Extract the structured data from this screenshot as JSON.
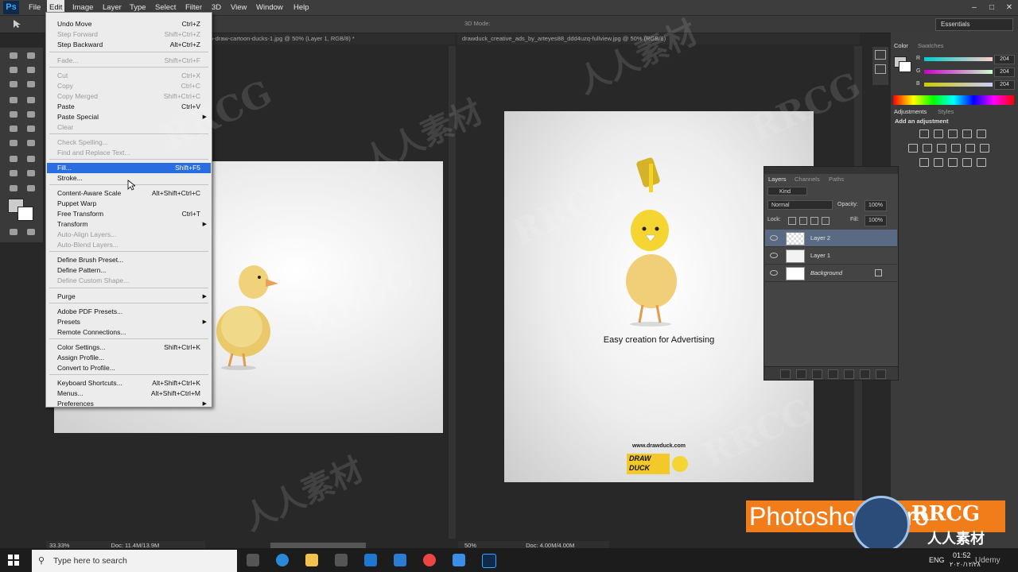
{
  "app": {
    "logo": "Ps"
  },
  "menubar": [
    "File",
    "Edit",
    "Image",
    "Layer",
    "Type",
    "Select",
    "Filter",
    "3D",
    "View",
    "Window",
    "Help"
  ],
  "options_bar": {
    "workspace": "Essentials",
    "mode": "3D Mode:"
  },
  "documents": [
    {
      "tab": "o-draw-cartoon-ducks-1.jpg @ 50% (Layer 1, RGB/8) *",
      "zoom": "33.33%",
      "doc_size": "Doc: 11.4M/13.9M"
    },
    {
      "tab": "drawduck_creative_ads_by_arteyes88_ddd4uzq-fullview.jpg @ 50% (RGB/8)",
      "zoom": "50%",
      "doc_size": "Doc: 4.00M/4.00M"
    }
  ],
  "edit_menu": {
    "items": [
      {
        "label": "Undo Move",
        "shortcut": "Ctrl+Z",
        "disabled": false
      },
      {
        "label": "Step Forward",
        "shortcut": "Shift+Ctrl+Z",
        "disabled": true
      },
      {
        "label": "Step Backward",
        "shortcut": "Alt+Ctrl+Z",
        "disabled": false
      },
      {
        "label": "Fade...",
        "shortcut": "Shift+Ctrl+F",
        "disabled": true
      },
      {
        "label": "Cut",
        "shortcut": "Ctrl+X",
        "disabled": true
      },
      {
        "label": "Copy",
        "shortcut": "Ctrl+C",
        "disabled": true
      },
      {
        "label": "Copy Merged",
        "shortcut": "Shift+Ctrl+C",
        "disabled": true
      },
      {
        "label": "Paste",
        "shortcut": "Ctrl+V",
        "disabled": false
      },
      {
        "label": "Paste Special",
        "shortcut": "",
        "disabled": false
      },
      {
        "label": "Clear",
        "shortcut": "",
        "disabled": true
      },
      {
        "label": "Check Spelling...",
        "shortcut": "",
        "disabled": true
      },
      {
        "label": "Find and Replace Text...",
        "shortcut": "",
        "disabled": true
      },
      {
        "label": "Fill...",
        "shortcut": "Shift+F5",
        "disabled": false
      },
      {
        "label": "Stroke...",
        "shortcut": "",
        "disabled": false
      },
      {
        "label": "Content-Aware Scale",
        "shortcut": "Alt+Shift+Ctrl+C",
        "disabled": false
      },
      {
        "label": "Puppet Warp",
        "shortcut": "",
        "disabled": false
      },
      {
        "label": "Free Transform",
        "shortcut": "Ctrl+T",
        "disabled": false
      },
      {
        "label": "Transform",
        "shortcut": "",
        "disabled": false
      },
      {
        "label": "Auto-Align Layers...",
        "shortcut": "",
        "disabled": true
      },
      {
        "label": "Auto-Blend Layers...",
        "shortcut": "",
        "disabled": true
      },
      {
        "label": "Define Brush Preset...",
        "shortcut": "",
        "disabled": false
      },
      {
        "label": "Define Pattern...",
        "shortcut": "",
        "disabled": false
      },
      {
        "label": "Define Custom Shape...",
        "shortcut": "",
        "disabled": true
      },
      {
        "label": "Purge",
        "shortcut": "",
        "disabled": false
      },
      {
        "label": "Adobe PDF Presets...",
        "shortcut": "",
        "disabled": false
      },
      {
        "label": "Presets",
        "shortcut": "",
        "disabled": false
      },
      {
        "label": "Remote Connections...",
        "shortcut": "",
        "disabled": false
      },
      {
        "label": "Color Settings...",
        "shortcut": "Shift+Ctrl+K",
        "disabled": false
      },
      {
        "label": "Assign Profile...",
        "shortcut": "",
        "disabled": false
      },
      {
        "label": "Convert to Profile...",
        "shortcut": "",
        "disabled": false
      },
      {
        "label": "Keyboard Shortcuts...",
        "shortcut": "Alt+Shift+Ctrl+K",
        "disabled": false
      },
      {
        "label": "Menus...",
        "shortcut": "Alt+Shift+Ctrl+M",
        "disabled": false
      },
      {
        "label": "Preferences",
        "shortcut": "",
        "disabled": false
      }
    ]
  },
  "color_panel": {
    "tabs": [
      "Color",
      "Swatches"
    ],
    "channels": [
      {
        "name": "R",
        "value": "204"
      },
      {
        "name": "G",
        "value": "204"
      },
      {
        "name": "B",
        "value": "204"
      }
    ]
  },
  "adjustments_panel": {
    "tabs": [
      "Adjustments",
      "Styles"
    ],
    "heading": "Add an adjustment"
  },
  "layers_panel": {
    "tabs": [
      "Layers",
      "Channels",
      "Paths"
    ],
    "filter": "Kind",
    "blend_mode": "Normal",
    "opacity_label": "Opacity:",
    "opacity": "100%",
    "lock_label": "Lock:",
    "fill_label": "Fill:",
    "fill": "100%",
    "layers": [
      {
        "name": "Layer 2",
        "selected": true
      },
      {
        "name": "Layer 1",
        "selected": false
      },
      {
        "name": "Background",
        "selected": false
      }
    ]
  },
  "ad": {
    "tagline": "Easy creation for Advertising",
    "url": "www.drawduck.com",
    "brand_line1": "DRAW",
    "brand_line2": "DUCK"
  },
  "banner": {
    "text": "Photoshop Intro"
  },
  "watermark": {
    "text": "RRCG",
    "cn": "人人素材"
  },
  "taskbar": {
    "search_placeholder": "Type here to search",
    "language": "ENG",
    "time": "01:52",
    "date": "۲۰۲۰/۱۲/۲۸",
    "tray_app": "Udemy"
  }
}
